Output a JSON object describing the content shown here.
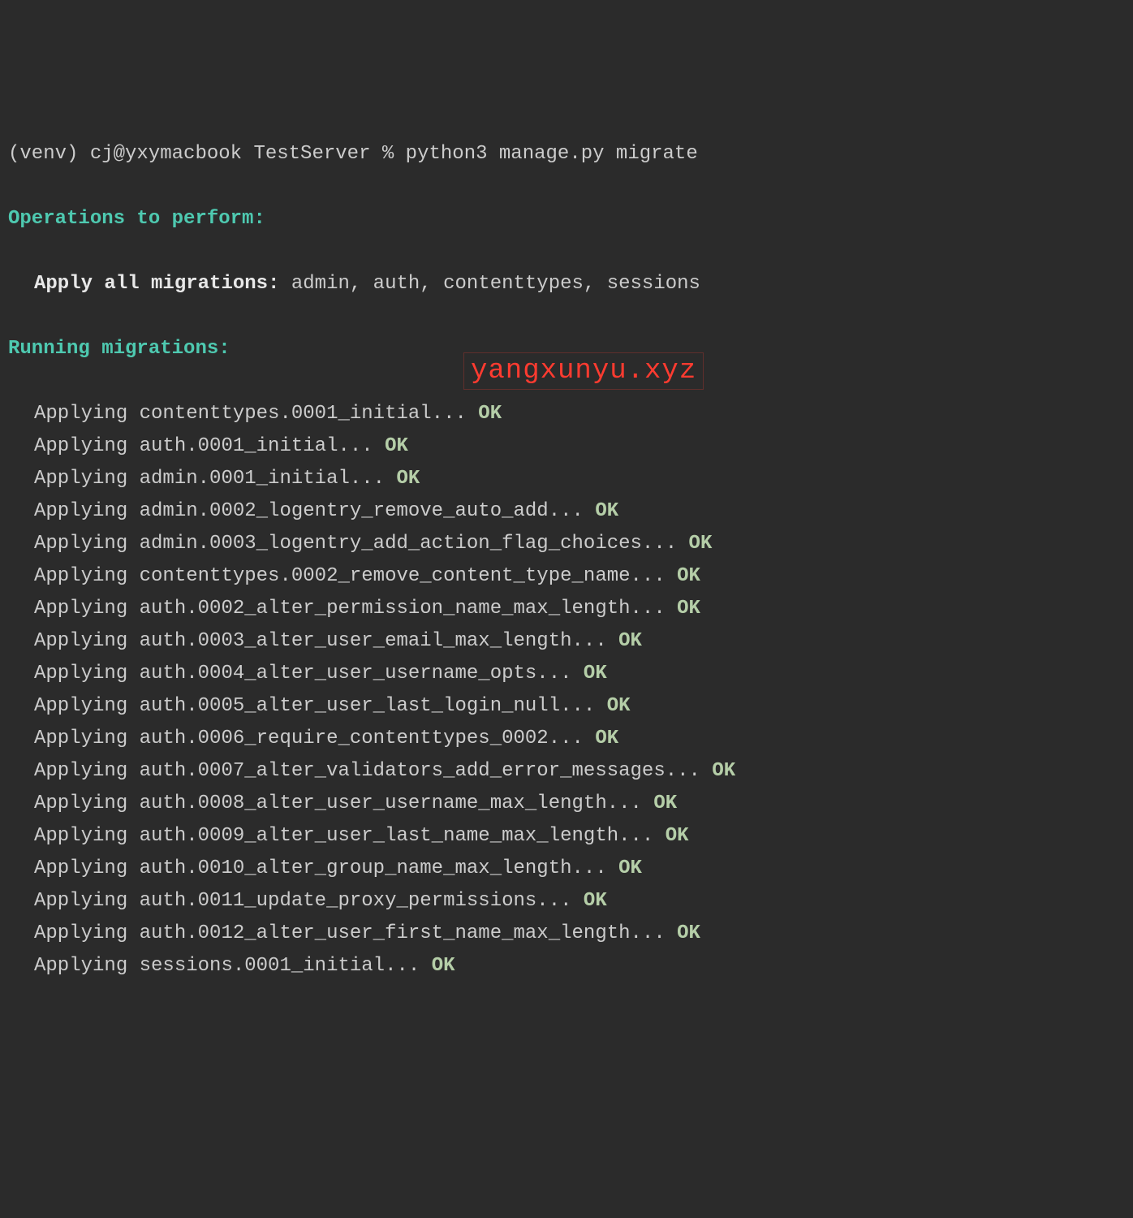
{
  "prompt_line": "(venv) cj@yxymacbook TestServer % python3 manage.py migrate",
  "operations_header": "Operations to perform:",
  "apply_all_label": "Apply all migrations:",
  "apply_all_list": " admin, auth, contenttypes, sessions",
  "running_header": "Running migrations:",
  "applying_prefix": "Applying ",
  "ok_label": "OK",
  "migrations": [
    {
      "name": "contenttypes.0001_initial... "
    },
    {
      "name": "auth.0001_initial... "
    },
    {
      "name": "admin.0001_initial... "
    },
    {
      "name": "admin.0002_logentry_remove_auto_add... "
    },
    {
      "name": "admin.0003_logentry_add_action_flag_choices... "
    },
    {
      "name": "contenttypes.0002_remove_content_type_name... "
    },
    {
      "name": "auth.0002_alter_permission_name_max_length... "
    },
    {
      "name": "auth.0003_alter_user_email_max_length... "
    },
    {
      "name": "auth.0004_alter_user_username_opts... "
    },
    {
      "name": "auth.0005_alter_user_last_login_null... "
    },
    {
      "name": "auth.0006_require_contenttypes_0002... "
    },
    {
      "name": "auth.0007_alter_validators_add_error_messages... "
    },
    {
      "name": "auth.0008_alter_user_username_max_length... "
    },
    {
      "name": "auth.0009_alter_user_last_name_max_length... "
    },
    {
      "name": "auth.0010_alter_group_name_max_length... "
    },
    {
      "name": "auth.0011_update_proxy_permissions... "
    },
    {
      "name": "auth.0012_alter_user_first_name_max_length... "
    },
    {
      "name": "sessions.0001_initial... "
    }
  ],
  "watermark": "yangxunyu.xyz"
}
